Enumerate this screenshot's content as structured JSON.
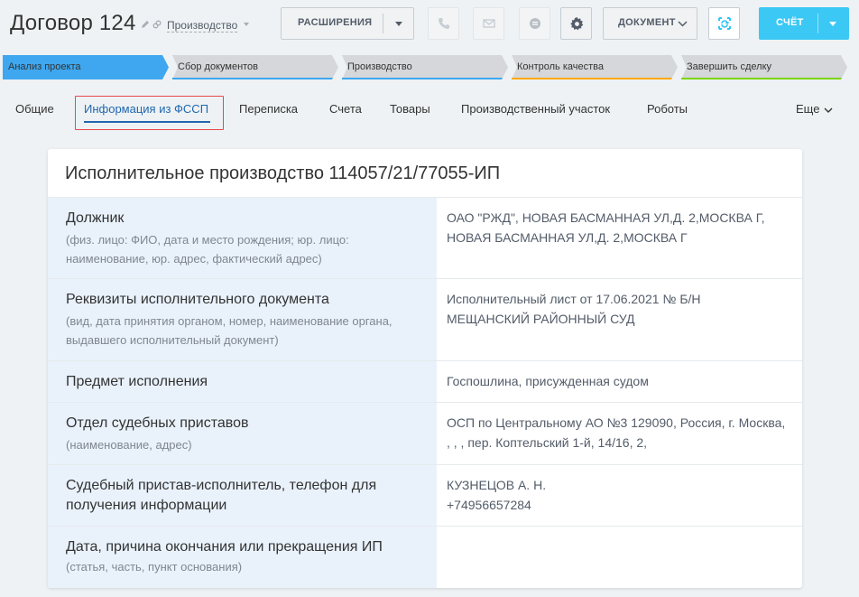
{
  "header": {
    "title": "Договор 124",
    "category": "Производство",
    "extensions_label": "РАСШИРЕНИЯ",
    "document_label": "ДОКУМЕНТ",
    "invoice_label": "СЧЁТ"
  },
  "stages": [
    {
      "label": "Анализ проекта",
      "color": "#2fc6f6",
      "active": true
    },
    {
      "label": "Сбор документов",
      "color": "#2fc6f6",
      "active": false
    },
    {
      "label": "Производство",
      "color": "#2fc6f6",
      "active": false
    },
    {
      "label": "Контроль качества",
      "color": "#ffa900",
      "active": false
    },
    {
      "label": "Завершить сделку",
      "color": "#7bd500",
      "active": false
    }
  ],
  "tabs": [
    {
      "label": "Общие"
    },
    {
      "label": "Информация из ФССП"
    },
    {
      "label": "Переписка"
    },
    {
      "label": "Счета"
    },
    {
      "label": "Товары"
    },
    {
      "label": "Производственный участок"
    },
    {
      "label": "Роботы"
    }
  ],
  "tab_more": "Еще",
  "card": {
    "title": "Исполнительное производство 114057/21/77055-ИП",
    "rows": [
      {
        "label": "Должник",
        "hint": "(физ. лицо: ФИО, дата и место рождения; юр. лицо: наименование, юр. адрес, фактический адрес)",
        "value": "ОАО \"РЖД\", НОВАЯ БАСМАННАЯ УЛ,Д. 2,МОСКВА Г, НОВАЯ БАСМАННАЯ УЛ,Д. 2,МОСКВА Г"
      },
      {
        "label": "Реквизиты исполнительного документа",
        "hint": "(вид, дата принятия органом, номер, наименование органа, выдавшего исполнительный документ)",
        "value_line1": "Исполнительный лист от 17.06.2021 № Б/Н",
        "value_line2": "МЕЩАНСКИЙ РАЙОННЫЙ СУД"
      },
      {
        "label": "Предмет исполнения",
        "hint": "",
        "value": "Госпошлина, присужденная судом"
      },
      {
        "label": "Отдел судебных приставов",
        "hint": "(наименование, адрес)",
        "value": "ОСП по Центральному АО №3 129090, Россия, г. Москва, , , , пер. Коптельский 1-й, 14/16, 2,"
      },
      {
        "label": "Судебный пристав-исполнитель, телефон для получения информации",
        "hint": "",
        "value_line1": "КУЗНЕЦОВ А. Н.",
        "value_line2": "+74956657284"
      },
      {
        "label": "Дата, причина окончания или прекращения ИП",
        "hint": "(статья, часть, пункт основания)",
        "value": ""
      }
    ]
  }
}
